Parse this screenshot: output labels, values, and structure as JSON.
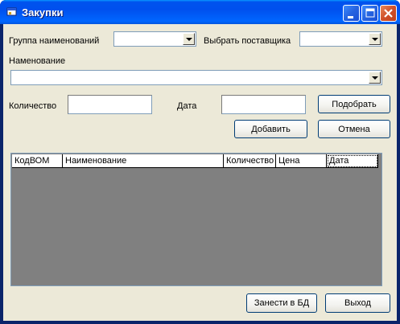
{
  "window": {
    "title": "Закупки"
  },
  "form": {
    "group_label": "Группа наименований",
    "group_value": "",
    "supplier_label": "Выбрать поставщика",
    "supplier_value": "",
    "name_label": "Наменование",
    "name_value": "",
    "quantity_label": "Количество",
    "quantity_value": "",
    "date_label": "Дата",
    "date_value": ""
  },
  "buttons": {
    "pick": "Подобрать",
    "add": "Добавить",
    "cancel": "Отмена",
    "save_db": "Занести в БД",
    "exit": "Выход"
  },
  "grid": {
    "columns": [
      "КодВОМ",
      "Наименование",
      "Количество",
      "Цена",
      "Дата"
    ],
    "rows": []
  },
  "colors": {
    "titlebar": "#0054e3",
    "face": "#ece9d8",
    "grid_background": "#808080"
  },
  "icons": [
    "app-icon",
    "minimize-icon",
    "maximize-icon",
    "close-icon",
    "chevron-down-icon"
  ]
}
